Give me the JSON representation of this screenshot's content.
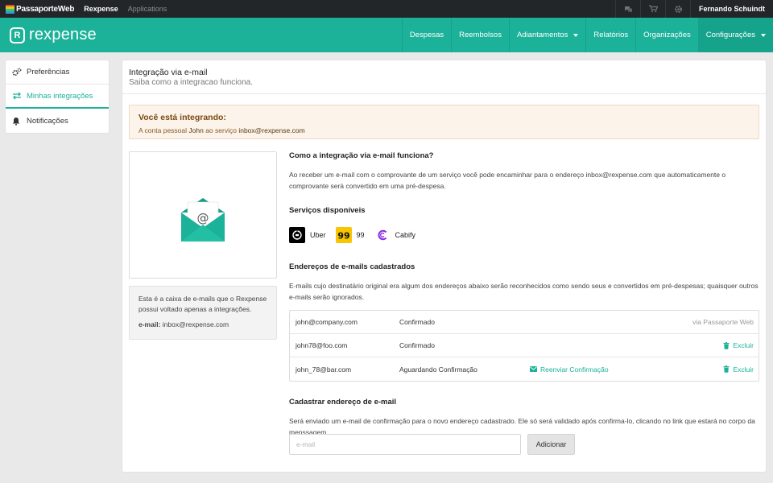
{
  "topbar": {
    "brand": "PassaporteWeb",
    "links": [
      "Rexpense",
      "Applications"
    ],
    "icons": [
      "chat-icon",
      "cart-icon",
      "gear-icon"
    ],
    "user": "Fernando Schuindt"
  },
  "navbar": {
    "brand": "rexpense",
    "items": [
      {
        "label": "Despesas"
      },
      {
        "label": "Reembolsos"
      },
      {
        "label": "Adiantamentos"
      },
      {
        "label": "Relatórios"
      },
      {
        "label": "Organizações"
      },
      {
        "label": "Configurações"
      }
    ]
  },
  "sidebar": {
    "items": [
      {
        "label": "Preferências",
        "icon": "gears-icon"
      },
      {
        "label": "Minhas integrações",
        "icon": "exchange-icon"
      },
      {
        "label": "Notificações",
        "icon": "bell-icon"
      }
    ]
  },
  "main": {
    "title": "Integração via e-mail",
    "subtitle": "Saiba como a integracao funciona.",
    "alert": {
      "title": "Você está integrando:",
      "text_prefix": "A conta pessoal",
      "account": "John",
      "text_middle": "ao serviço",
      "inbox": "inbox@rexpense.com"
    },
    "info_box": {
      "text": "Esta é a caixa de e-mails que o Rexpense possui voltado apenas a integrações.",
      "email_label": "e-mail:",
      "email_value": "inbox@rexpense.com"
    },
    "how": {
      "title": "Como a integração via e-mail funciona?",
      "text_before": "Ao receber um e-mail com o comprovante de um serviço você pode encaminhar para o endereço",
      "email": "inbox@rexpense.com",
      "text_after": "que automaticamente o comprovante será convertido em uma pré-despesa."
    },
    "services": {
      "title": "Serviços disponíveis",
      "items": [
        {
          "name": "Uber",
          "color": "#000000"
        },
        {
          "name": "99",
          "color": "#f7c600"
        },
        {
          "name": "Cabify",
          "color": "#8a2be2"
        }
      ]
    },
    "registered": {
      "title": "Endereços de e-mails cadastrados",
      "text": "E-mails cujo destinatário original era algum dos endereços abaixo serão reconhecidos como sendo seus e convertidos em pré-despesas; quaisquer outros e-mails serão ignorados.",
      "rows": [
        {
          "email": "john@company.com",
          "status": "Confirmado",
          "action": "",
          "right": "via Passaporte Web"
        },
        {
          "email": "john78@foo.com",
          "status": "Confirmado",
          "action": "",
          "right": "Excluir"
        },
        {
          "email": "john_78@bar.com",
          "status": "Aguardando Confirmação",
          "action": "Reenviar Confirmação",
          "right": "Excluir"
        }
      ]
    },
    "register": {
      "title": "Cadastrar endereço de e-mail",
      "text": "Será enviado um e-mail de confirmação para o novo endereço cadastrado. Ele só será validado após confirma-lo, clicando no link que estará no corpo da menssagem.",
      "placeholder": "e-mail",
      "button": "Adicionar"
    }
  },
  "colors": {
    "accent": "#1cb199",
    "topbar": "#222629",
    "alert_bg": "#fcf3ea"
  }
}
